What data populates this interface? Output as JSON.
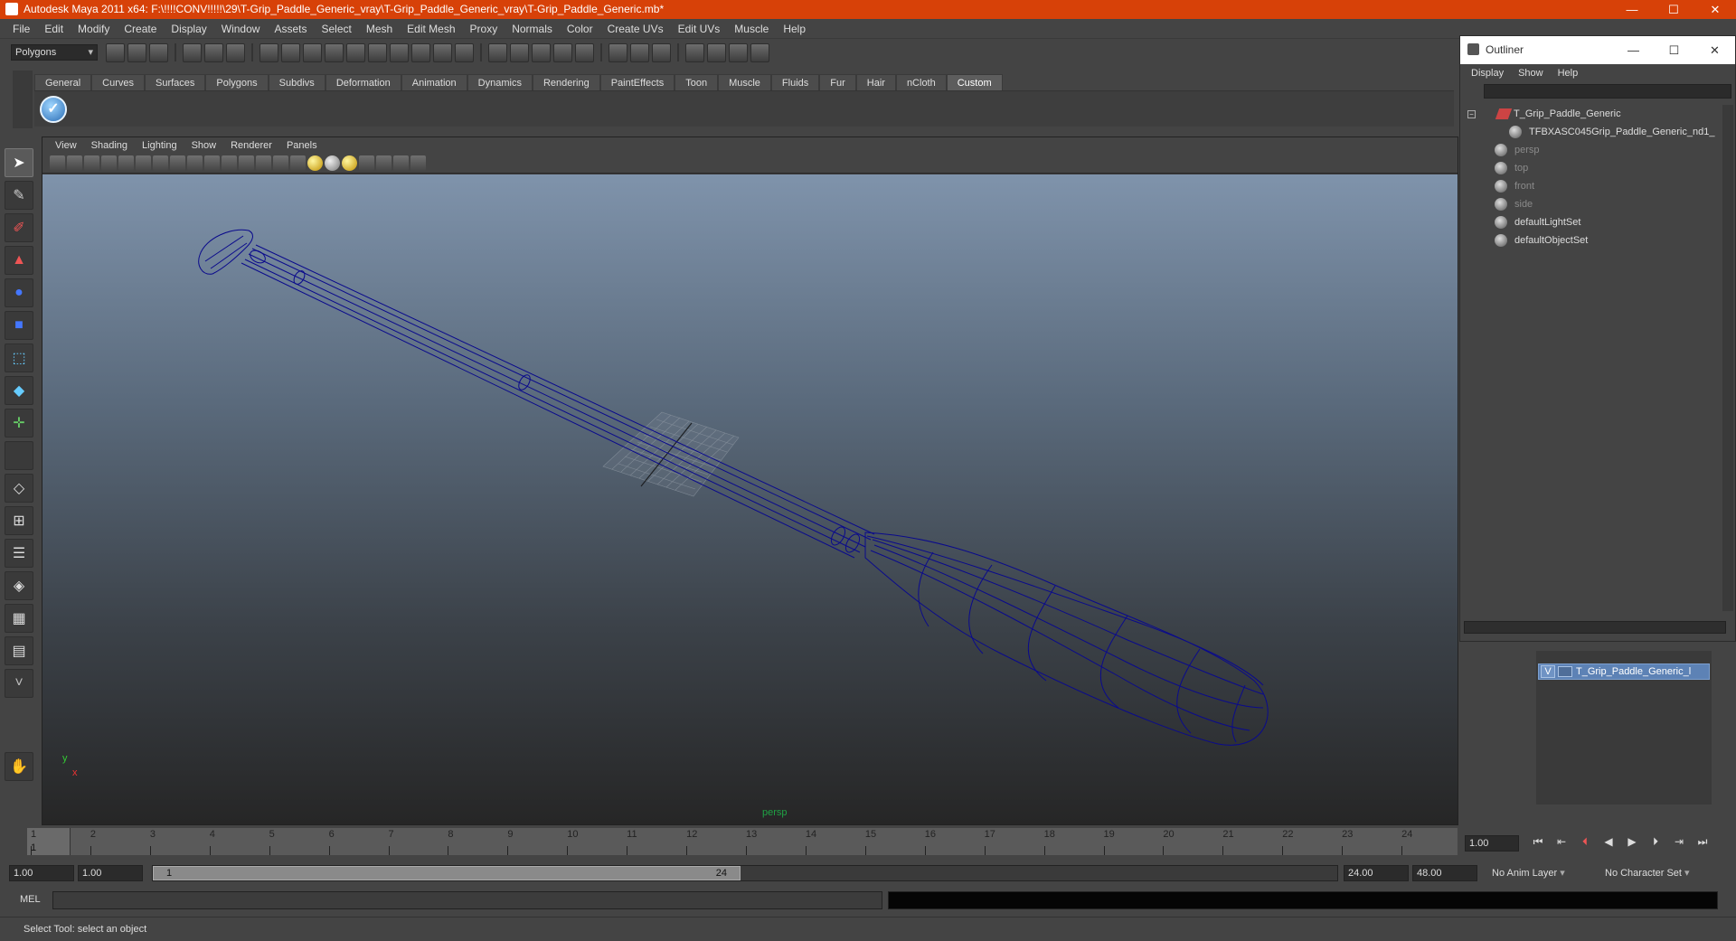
{
  "window": {
    "title": "Autodesk Maya 2011 x64: F:\\!!!!CONV!!!!!\\29\\T-Grip_Paddle_Generic_vray\\T-Grip_Paddle_Generic_vray\\T-Grip_Paddle_Generic.mb*",
    "minimize": "—",
    "maximize": "☐",
    "close": "✕"
  },
  "menubar": {
    "items": [
      "File",
      "Edit",
      "Modify",
      "Create",
      "Display",
      "Window",
      "Assets",
      "Select",
      "Mesh",
      "Edit Mesh",
      "Proxy",
      "Normals",
      "Color",
      "Create UVs",
      "Edit UVs",
      "Muscle",
      "Help"
    ]
  },
  "statusline": {
    "mode": "Polygons"
  },
  "shelf": {
    "tabs": [
      "General",
      "Curves",
      "Surfaces",
      "Polygons",
      "Subdivs",
      "Deformation",
      "Animation",
      "Dynamics",
      "Rendering",
      "PaintEffects",
      "Toon",
      "Muscle",
      "Fluids",
      "Fur",
      "Hair",
      "nCloth",
      "Custom"
    ],
    "active_tab": "Custom",
    "check_glyph": "✓"
  },
  "viewport": {
    "menu": [
      "View",
      "Shading",
      "Lighting",
      "Show",
      "Renderer",
      "Panels"
    ],
    "camera": "persp",
    "axis_y": "y",
    "axis_x": "x"
  },
  "outliner": {
    "title": "Outliner",
    "menu": [
      "Display",
      "Show",
      "Help"
    ],
    "items": [
      {
        "label": "T_Grip_Paddle_Generic",
        "dim": false,
        "expand": "−"
      },
      {
        "label": "TFBXASC045Grip_Paddle_Generic_nd1_",
        "dim": false
      },
      {
        "label": "persp",
        "dim": true
      },
      {
        "label": "top",
        "dim": true
      },
      {
        "label": "front",
        "dim": true
      },
      {
        "label": "side",
        "dim": true
      },
      {
        "label": "defaultLightSet",
        "dim": false
      },
      {
        "label": "defaultObjectSet",
        "dim": false
      }
    ]
  },
  "layers": {
    "visible": "V",
    "name": "T_Grip_Paddle_Generic_l"
  },
  "timeline": {
    "ticks": [
      "1",
      "2",
      "3",
      "4",
      "5",
      "6",
      "7",
      "8",
      "9",
      "10",
      "11",
      "12",
      "13",
      "14",
      "15",
      "16",
      "17",
      "18",
      "19",
      "20",
      "21",
      "22",
      "23",
      "24"
    ],
    "current_frame": "1",
    "frame_field": "1.00"
  },
  "range": {
    "start_time": "1.00",
    "playback_start": "1.00",
    "handle_start": "1",
    "handle_end": "24",
    "playback_end": "24.00",
    "end_time": "48.00",
    "anim_layer": "No Anim Layer",
    "character_set": "No Character Set"
  },
  "command": {
    "label": "MEL"
  },
  "help": {
    "text": "Select Tool: select an object"
  },
  "colors": {
    "titlebar": "#d74108",
    "wireframe": "#0a0a8c",
    "camera_label": "#1fa244",
    "layer_selected": "#5d82b5"
  }
}
